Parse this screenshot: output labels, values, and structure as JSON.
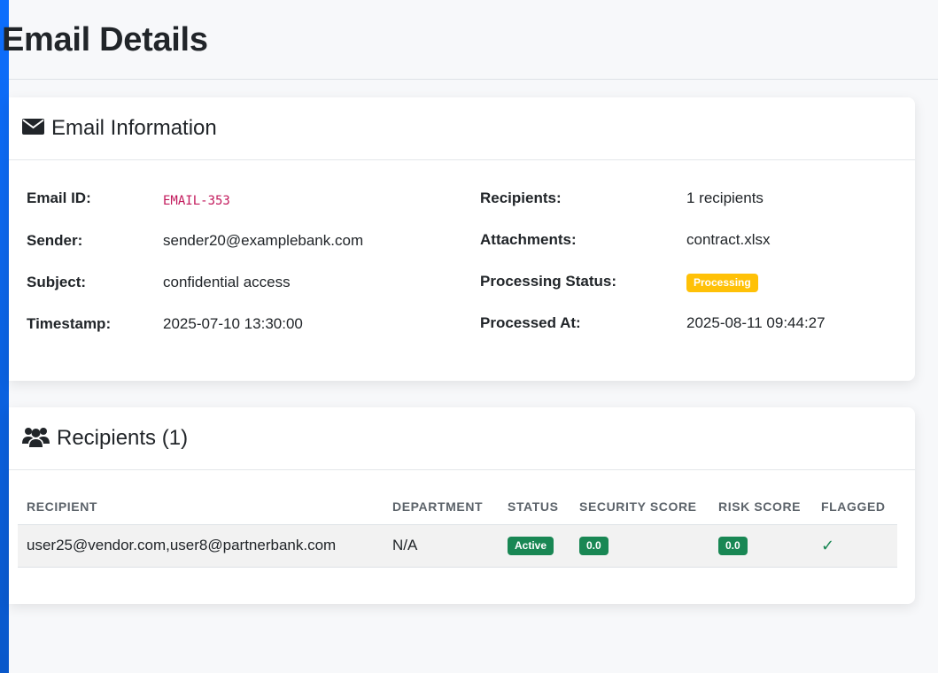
{
  "page": {
    "title": "Email Details"
  },
  "email_info": {
    "title": "Email Information",
    "icon": "envelope-icon",
    "fields_left": [
      {
        "label": "Email ID:",
        "value": "EMAIL-353"
      },
      {
        "label": "Sender:",
        "value": "sender20@examplebank.com"
      },
      {
        "label": "Subject:",
        "value": "confidential access"
      },
      {
        "label": "Timestamp:",
        "value": "2025-07-10 13:30:00"
      }
    ],
    "fields_right": [
      {
        "label": "Recipients:",
        "value": "1 recipients"
      },
      {
        "label": "Attachments:",
        "value": "contract.xlsx"
      },
      {
        "label": "Processing Status:",
        "value": "Processing"
      },
      {
        "label": "Processed At:",
        "value": "2025-08-11 09:44:27"
      }
    ]
  },
  "recipients": {
    "title": "Recipients (1)",
    "icon": "users-icon",
    "columns": [
      "RECIPIENT",
      "DEPARTMENT",
      "STATUS",
      "SECURITY SCORE",
      "RISK SCORE",
      "FLAGGED"
    ],
    "rows": [
      {
        "recipient": "user25@vendor.com,user8@partnerbank.com",
        "department": "N/A",
        "status": "Active",
        "security_score": "0.0",
        "risk_score": "0.0",
        "flagged": "✓"
      }
    ]
  },
  "colors": {
    "accent": "#0d6efd",
    "warning": "#ffc107",
    "success": "#198754",
    "code": "#c2185b"
  }
}
